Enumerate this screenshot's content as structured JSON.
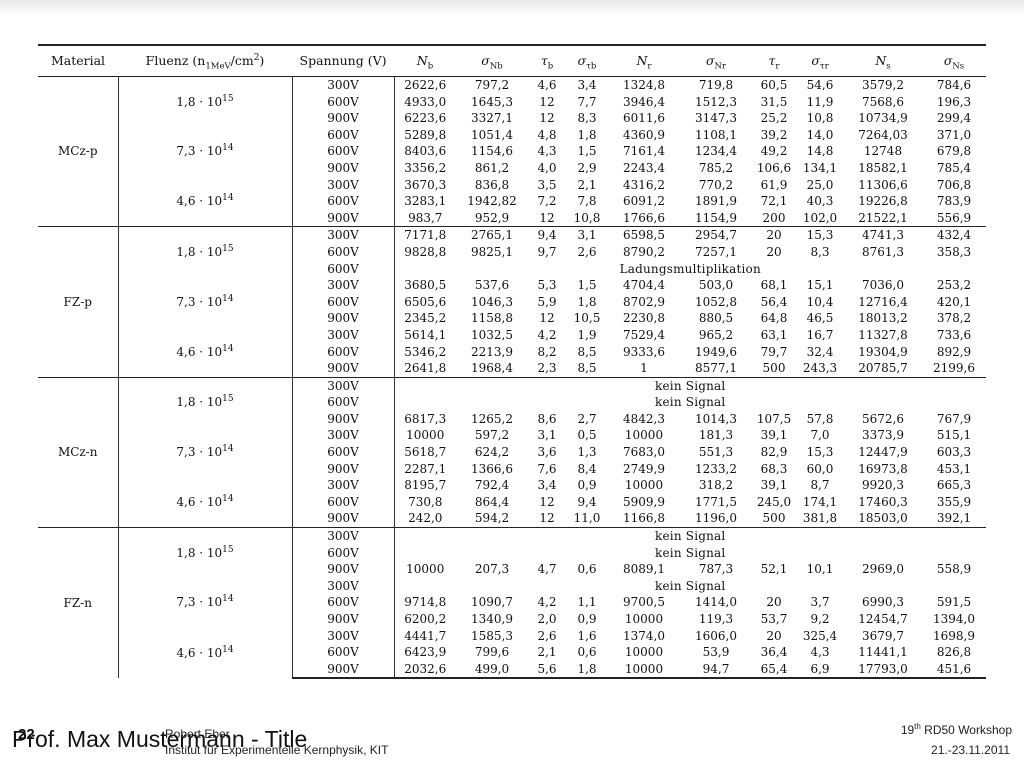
{
  "table": {
    "headers": {
      "material": "Material",
      "fluenz_label": "Fluenz (n",
      "fluenz_sub": "1MeV",
      "fluenz_unit": "/cm",
      "fluenz_sup": "2",
      "fluenz_close": ")",
      "spannung": "Spannung (V)",
      "nb": "N",
      "nb_sub": "b",
      "sigma_nb": "σ",
      "sigma_nb_sub": "Nb",
      "tau_b": "τ",
      "tau_b_sub": "b",
      "sigma_tau_b": "σ",
      "sigma_tau_b_sub": "τb",
      "nr": "N",
      "nr_sub": "r",
      "sigma_nr": "σ",
      "sigma_nr_sub": "Nr",
      "tau_r": "τ",
      "tau_r_sub": "r",
      "sigma_tau_r": "σ",
      "sigma_tau_r_sub": "τr",
      "ns": "N",
      "ns_sub": "s",
      "sigma_ns": "σ",
      "sigma_ns_sub": "Ns"
    },
    "groups": [
      {
        "material": "MCz-p",
        "fluences": [
          {
            "base": "1,8 · 10",
            "exp": "15",
            "rows": [
              {
                "v": "300V",
                "vals": [
                  "2622,6",
                  "797,2",
                  "4,6",
                  "3,4",
                  "1324,8",
                  "719,8",
                  "60,5",
                  "54,6",
                  "3579,2",
                  "784,6"
                ]
              },
              {
                "v": "600V",
                "vals": [
                  "4933,0",
                  "1645,3",
                  "12",
                  "7,7",
                  "3946,4",
                  "1512,3",
                  "31,5",
                  "11,9",
                  "7568,6",
                  "196,3"
                ]
              },
              {
                "v": "900V",
                "vals": [
                  "6223,6",
                  "3327,1",
                  "12",
                  "8,3",
                  "6011,6",
                  "3147,3",
                  "25,2",
                  "10,8",
                  "10734,9",
                  "299,4"
                ]
              }
            ]
          },
          {
            "base": "7,3 · 10",
            "exp": "14",
            "rows": [
              {
                "v": "600V",
                "vals": [
                  "5289,8",
                  "1051,4",
                  "4,8",
                  "1,8",
                  "4360,9",
                  "1108,1",
                  "39,2",
                  "14,0",
                  "7264,03",
                  "371,0"
                ]
              },
              {
                "v": "600V",
                "vals": [
                  "8403,6",
                  "1154,6",
                  "4,3",
                  "1,5",
                  "7161,4",
                  "1234,4",
                  "49,2",
                  "14,8",
                  "12748",
                  "679,8"
                ]
              },
              {
                "v": "900V",
                "vals": [
                  "3356,2",
                  "861,2",
                  "4,0",
                  "2,9",
                  "2243,4",
                  "785,2",
                  "106,6",
                  "134,1",
                  "18582,1",
                  "785,4"
                ]
              }
            ]
          },
          {
            "base": "4,6 · 10",
            "exp": "14",
            "rows": [
              {
                "v": "300V",
                "vals": [
                  "3670,3",
                  "836,8",
                  "3,5",
                  "2,1",
                  "4316,2",
                  "770,2",
                  "61,9",
                  "25,0",
                  "11306,6",
                  "706,8"
                ]
              },
              {
                "v": "600V",
                "vals": [
                  "3283,1",
                  "1942,82",
                  "7,2",
                  "7,8",
                  "6091,2",
                  "1891,9",
                  "72,1",
                  "40,3",
                  "19226,8",
                  "783,9"
                ]
              },
              {
                "v": "900V",
                "vals": [
                  "983,7",
                  "952,9",
                  "12",
                  "10,8",
                  "1766,6",
                  "1154,9",
                  "200",
                  "102,0",
                  "21522,1",
                  "556,9"
                ]
              }
            ]
          }
        ]
      },
      {
        "material": "FZ-p",
        "fluences": [
          {
            "base": "1,8 · 10",
            "exp": "15",
            "rows": [
              {
                "v": "300V",
                "vals": [
                  "7171,8",
                  "2765,1",
                  "9,4",
                  "3,1",
                  "6598,5",
                  "2954,7",
                  "20",
                  "15,3",
                  "4741,3",
                  "432,4"
                ]
              },
              {
                "v": "600V",
                "vals": [
                  "9828,8",
                  "9825,1",
                  "9,7",
                  "2,6",
                  "8790,2",
                  "7257,1",
                  "20",
                  "8,3",
                  "8761,3",
                  "358,3"
                ]
              },
              {
                "v": "600V",
                "merged": "Ladungsmultiplikation"
              }
            ]
          },
          {
            "base": "7,3 · 10",
            "exp": "14",
            "rows": [
              {
                "v": "300V",
                "vals": [
                  "3680,5",
                  "537,6",
                  "5,3",
                  "1,5",
                  "4704,4",
                  "503,0",
                  "68,1",
                  "15,1",
                  "7036,0",
                  "253,2"
                ]
              },
              {
                "v": "600V",
                "vals": [
                  "6505,6",
                  "1046,3",
                  "5,9",
                  "1,8",
                  "8702,9",
                  "1052,8",
                  "56,4",
                  "10,4",
                  "12716,4",
                  "420,1"
                ]
              },
              {
                "v": "900V",
                "vals": [
                  "2345,2",
                  "1158,8",
                  "12",
                  "10,5",
                  "2230,8",
                  "880,5",
                  "64,8",
                  "46,5",
                  "18013,2",
                  "378,2"
                ]
              }
            ]
          },
          {
            "base": "4,6 · 10",
            "exp": "14",
            "rows": [
              {
                "v": "300V",
                "vals": [
                  "5614,1",
                  "1032,5",
                  "4,2",
                  "1,9",
                  "7529,4",
                  "965,2",
                  "63,1",
                  "16,7",
                  "11327,8",
                  "733,6"
                ]
              },
              {
                "v": "600V",
                "vals": [
                  "5346,2",
                  "2213,9",
                  "8,2",
                  "8,5",
                  "9333,6",
                  "1949,6",
                  "79,7",
                  "32,4",
                  "19304,9",
                  "892,9"
                ]
              },
              {
                "v": "900V",
                "vals": [
                  "2641,8",
                  "1968,4",
                  "2,3",
                  "8,5",
                  "1",
                  "8577,1",
                  "500",
                  "243,3",
                  "20785,7",
                  "2199,6"
                ]
              }
            ]
          }
        ]
      },
      {
        "material": "MCz-n",
        "fluences": [
          {
            "base": "1,8 · 10",
            "exp": "15",
            "rows": [
              {
                "v": "300V",
                "merged": "kein Signal"
              },
              {
                "v": "600V",
                "merged": "kein Signal"
              },
              {
                "v": "900V",
                "vals": [
                  "6817,3",
                  "1265,2",
                  "8,6",
                  "2,7",
                  "4842,3",
                  "1014,3",
                  "107,5",
                  "57,8",
                  "5672,6",
                  "767,9"
                ]
              }
            ]
          },
          {
            "base": "7,3 · 10",
            "exp": "14",
            "rows": [
              {
                "v": "300V",
                "vals": [
                  "10000",
                  "597,2",
                  "3,1",
                  "0,5",
                  "10000",
                  "181,3",
                  "39,1",
                  "7,0",
                  "3373,9",
                  "515,1"
                ]
              },
              {
                "v": "600V",
                "vals": [
                  "5618,7",
                  "624,2",
                  "3,6",
                  "1,3",
                  "7683,0",
                  "551,3",
                  "82,9",
                  "15,3",
                  "12447,9",
                  "603,3"
                ]
              },
              {
                "v": "900V",
                "vals": [
                  "2287,1",
                  "1366,6",
                  "7,6",
                  "8,4",
                  "2749,9",
                  "1233,2",
                  "68,3",
                  "60,0",
                  "16973,8",
                  "453,1"
                ]
              }
            ]
          },
          {
            "base": "4,6 · 10",
            "exp": "14",
            "rows": [
              {
                "v": "300V",
                "vals": [
                  "8195,7",
                  "792,4",
                  "3,4",
                  "0,9",
                  "10000",
                  "318,2",
                  "39,1",
                  "8,7",
                  "9920,3",
                  "665,3"
                ]
              },
              {
                "v": "600V",
                "vals": [
                  "730,8",
                  "864,4",
                  "12",
                  "9,4",
                  "5909,9",
                  "1771,5",
                  "245,0",
                  "174,1",
                  "17460,3",
                  "355,9"
                ]
              },
              {
                "v": "900V",
                "vals": [
                  "242,0",
                  "594,2",
                  "12",
                  "11,0",
                  "1166,8",
                  "1196,0",
                  "500",
                  "381,8",
                  "18503,0",
                  "392,1"
                ]
              }
            ]
          }
        ]
      },
      {
        "material": "FZ-n",
        "fluences": [
          {
            "base": "1,8 · 10",
            "exp": "15",
            "rows": [
              {
                "v": "300V",
                "merged": "kein Signal"
              },
              {
                "v": "600V",
                "merged": "kein Signal"
              },
              {
                "v": "900V",
                "vals": [
                  "10000",
                  "207,3",
                  "4,7",
                  "0,6",
                  "8089,1",
                  "787,3",
                  "52,1",
                  "10,1",
                  "2969,0",
                  "558,9"
                ]
              }
            ]
          },
          {
            "base": "7,3 · 10",
            "exp": "14",
            "rows": [
              {
                "v": "300V",
                "merged": "kein Signal"
              },
              {
                "v": "600V",
                "vals": [
                  "9714,8",
                  "1090,7",
                  "4,2",
                  "1,1",
                  "9700,5",
                  "1414,0",
                  "20",
                  "3,7",
                  "6990,3",
                  "591,5"
                ]
              },
              {
                "v": "900V",
                "vals": [
                  "6200,2",
                  "1340,9",
                  "2,0",
                  "0,9",
                  "10000",
                  "119,3",
                  "53,7",
                  "9,2",
                  "12454,7",
                  "1394,0"
                ]
              }
            ]
          },
          {
            "base": "4,6 · 10",
            "exp": "14",
            "rows": [
              {
                "v": "300V",
                "vals": [
                  "4441,7",
                  "1585,3",
                  "2,6",
                  "1,6",
                  "1374,0",
                  "1606,0",
                  "20",
                  "325,4",
                  "3679,7",
                  "1698,9"
                ]
              },
              {
                "v": "600V",
                "vals": [
                  "6423,9",
                  "799,6",
                  "2,1",
                  "0,6",
                  "10000",
                  "53,9",
                  "36,4",
                  "4,3",
                  "11441,1",
                  "826,8"
                ]
              },
              {
                "v": "900V",
                "vals": [
                  "2032,6",
                  "499,0",
                  "5,6",
                  "1,8",
                  "10000",
                  "94,7",
                  "65,4",
                  "6,9",
                  "17793,0",
                  "451,6"
                ]
              }
            ]
          }
        ]
      }
    ]
  },
  "footer": {
    "page_number": "22",
    "title": "Prof. Max Mustermann - Title",
    "author": "Robert Eber",
    "institute": "Institut für Experimentelle Kernphysik, KIT",
    "event_pre": "19",
    "event_sup": "th",
    "event_post": " RD50 Workshop",
    "date": "21.-23.11.2011"
  }
}
